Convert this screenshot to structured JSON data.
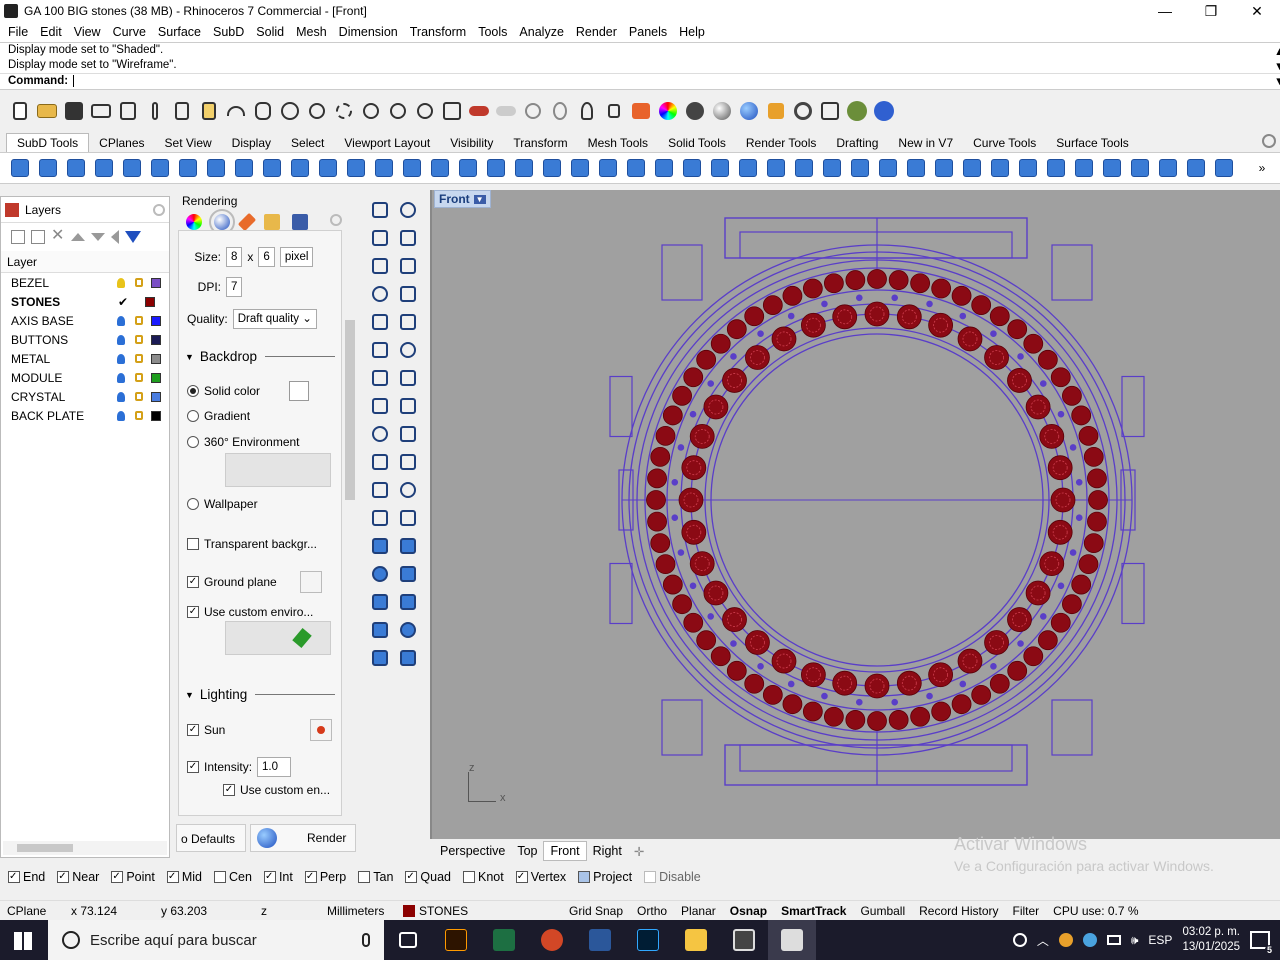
{
  "window": {
    "title": "GA 100 BIG stones (38 MB) - Rhinoceros 7 Commercial - [Front]",
    "min_glyph": "—",
    "max_glyph": "❐",
    "close_glyph": "✕"
  },
  "menu": [
    "File",
    "Edit",
    "View",
    "Curve",
    "Surface",
    "SubD",
    "Solid",
    "Mesh",
    "Dimension",
    "Transform",
    "Tools",
    "Analyze",
    "Render",
    "Panels",
    "Help"
  ],
  "command_history": {
    "line1": "Display mode set to \"Shaded\".",
    "line2": "Display mode set to \"Wireframe\".",
    "prompt": "Command:"
  },
  "toolbar_tabs": [
    "SubD Tools",
    "CPlanes",
    "Set View",
    "Display",
    "Select",
    "Viewport Layout",
    "Visibility",
    "Transform",
    "Mesh Tools",
    "Solid Tools",
    "Render Tools",
    "Drafting",
    "New in V7",
    "Curve Tools",
    "Surface Tools"
  ],
  "layers": {
    "title": "Layers",
    "column": "Layer",
    "rows": [
      {
        "name": "BEZEL",
        "color": "#7a4fc4",
        "current": false,
        "bulb_color": "#e8c31a"
      },
      {
        "name": "STONES",
        "color": "#8b0000",
        "current": true,
        "check": "✔"
      },
      {
        "name": "AXIS BASE",
        "color": "#1a1aff",
        "current": false,
        "bulb_color": "#2b6fd6"
      },
      {
        "name": "BUTTONS",
        "color": "#1b1b55",
        "current": false,
        "bulb_color": "#2b6fd6"
      },
      {
        "name": "METAL",
        "color": "#8c8c8c",
        "current": false,
        "bulb_color": "#2b6fd6"
      },
      {
        "name": "MODULE",
        "color": "#1e9e1e",
        "current": false,
        "bulb_color": "#2b6fd6"
      },
      {
        "name": "CRYSTAL",
        "color": "#4a7de0",
        "current": false,
        "bulb_color": "#2b6fd6"
      },
      {
        "name": "BACK PLATE",
        "color": "#000000",
        "current": false,
        "bulb_color": "#2b6fd6"
      }
    ]
  },
  "rendering": {
    "title": "Rendering",
    "size_label": "Size:",
    "size_w": "8",
    "size_x": "x",
    "size_h": "6",
    "size_unit": "pixel",
    "dpi_label": "DPI:",
    "dpi": "7",
    "quality_label": "Quality:",
    "quality": "Draft quality",
    "backdrop": "Backdrop",
    "solid_color": "Solid color",
    "gradient": "Gradient",
    "env360": "360° Environment",
    "wallpaper": "Wallpaper",
    "transparent": "Transparent backgr...",
    "ground_plane": "Ground plane",
    "use_custom_env": "Use custom enviro...",
    "lighting": "Lighting",
    "sun": "Sun",
    "intensity_label": "Intensity:",
    "intensity": "1.0",
    "use_custom_en": "Use custom en...",
    "defaults_btn": "o Defaults",
    "render_btn": "Render"
  },
  "viewport": {
    "name": "Front",
    "axis_z": "z",
    "axis_x": "x",
    "tabs": [
      "Perspective",
      "Top",
      "Front",
      "Right"
    ],
    "add_tab": "✛",
    "active_tab": "Front",
    "watermark_line1": "Activar Windows",
    "watermark_line2": "Ve a Configuración para activar Windows."
  },
  "osnap": [
    {
      "label": "End",
      "checked": true
    },
    {
      "label": "Near",
      "checked": true
    },
    {
      "label": "Point",
      "checked": true
    },
    {
      "label": "Mid",
      "checked": true
    },
    {
      "label": "Cen",
      "checked": false
    },
    {
      "label": "Int",
      "checked": true
    },
    {
      "label": "Perp",
      "checked": true
    },
    {
      "label": "Tan",
      "checked": false
    },
    {
      "label": "Quad",
      "checked": true
    },
    {
      "label": "Knot",
      "checked": false
    },
    {
      "label": "Vertex",
      "checked": true
    },
    {
      "label": "Project",
      "checked": false
    },
    {
      "label": "Disable",
      "checked": false
    }
  ],
  "status": {
    "cplane": "CPlane",
    "x": "x 73.124",
    "y": "y 63.203",
    "z": "z",
    "units": "Millimeters",
    "layer": "STONES",
    "layer_color": "#8b0000",
    "grid_snap": "Grid Snap",
    "ortho": "Ortho",
    "planar": "Planar",
    "osnap": "Osnap",
    "smarttrack": "SmartTrack",
    "gumball": "Gumball",
    "record_history": "Record History",
    "filter": "Filter",
    "cpu": "CPU use: 0.7 %"
  },
  "taskbar": {
    "search_placeholder": "Escribe aquí para buscar",
    "lang": "ESP",
    "time": "03:02 p. m.",
    "date": "13/01/2025",
    "notif": "5"
  },
  "colors": {
    "wire": "#5a3ec8",
    "stone": "#8b0a14",
    "viewport_bg": "#a0a0a0"
  }
}
